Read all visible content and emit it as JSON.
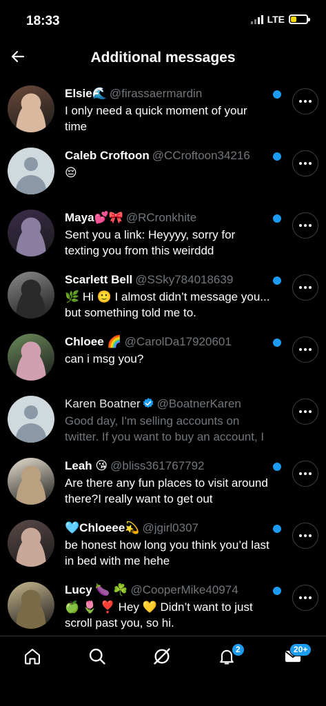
{
  "status_bar": {
    "time": "18:33",
    "network": "LTE",
    "battery_level": 0.35,
    "battery_color": "#f5d90a"
  },
  "header": {
    "title": "Additional messages"
  },
  "conversations": [
    {
      "name": "Elsie🌊",
      "handle": "@firassaermardin",
      "message": "I only need a quick moment of your time",
      "unread": true,
      "avatar": "photo"
    },
    {
      "name": "Caleb Croftoon",
      "handle": "@CCroftoon34216",
      "message": "😔",
      "unread": true,
      "avatar": "default"
    },
    {
      "name": "Maya💕🎀",
      "handle": "@RCronkhite",
      "message": "Sent you a link: Heyyyy, sorry for texting you from this weirddd",
      "unread": true,
      "avatar": "photo"
    },
    {
      "name": "Scarlett Bell",
      "handle": "@SSky784018639",
      "message": "🌿 Hi 🙂 I almost didn’t message you... but something told me to.",
      "unread": true,
      "avatar": "photo"
    },
    {
      "name": "Chloee 🌈",
      "handle": "@CarolDa17920601",
      "message": "can i msg you?",
      "unread": true,
      "avatar": "photo"
    },
    {
      "name": "Karen Boatner",
      "handle": "@BoatnerKaren",
      "message": "Good day, I'm selling accounts on twitter. If you want to buy an account, I",
      "unread": false,
      "verified": true,
      "avatar": "default"
    },
    {
      "name": "Leah 😘",
      "handle": "@bliss361767792",
      "message": "Are there any fun places to visit around there?I really want to get out",
      "unread": true,
      "avatar": "photo"
    },
    {
      "name": "🩵Chloeee💫",
      "handle": "@jgirl0307",
      "message": "be honest how long you think you’d last in bed with me hehe",
      "unread": true,
      "avatar": "photo"
    },
    {
      "name": "Lucy 🍆 ☘️",
      "handle": "@CooperMike40974",
      "message": "🍏 🌷 ❣️ Hey 💛 Didn’t want to just scroll past you, so hi.",
      "unread": true,
      "avatar": "photo"
    }
  ],
  "tabs": [
    {
      "name": "home-icon"
    },
    {
      "name": "search-icon"
    },
    {
      "name": "grok-icon"
    },
    {
      "name": "bell-icon",
      "badge": "2"
    },
    {
      "name": "mail-icon",
      "badge": "20+"
    }
  ],
  "colors": {
    "accent": "#1d9bf0",
    "background": "#000000",
    "muted": "#71767b"
  }
}
